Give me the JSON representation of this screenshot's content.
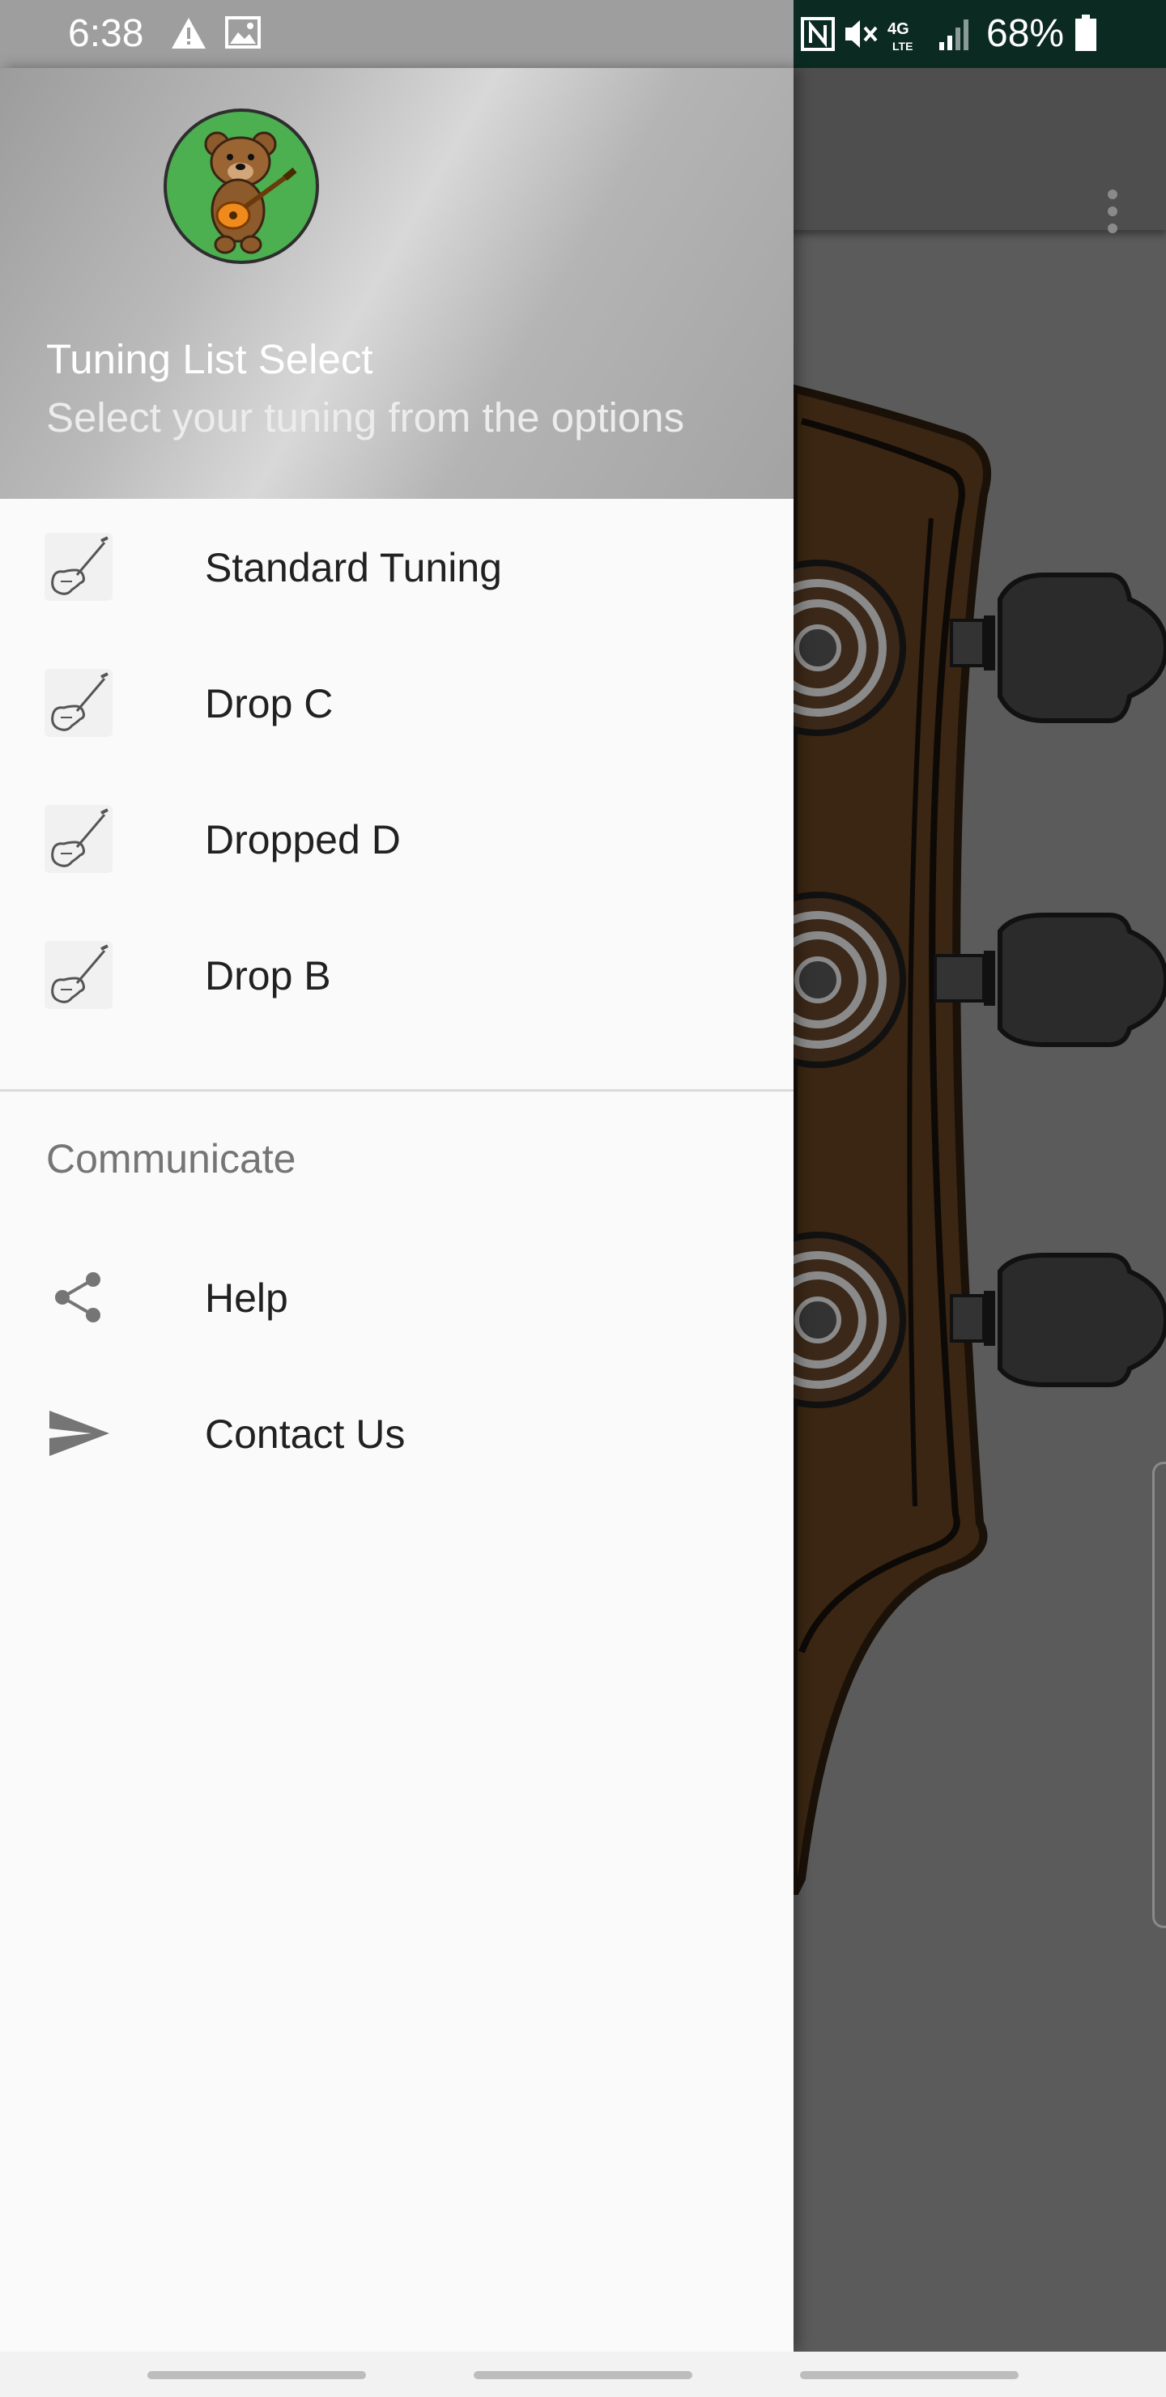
{
  "status_bar": {
    "time": "6:38",
    "battery": "68%",
    "left_icons": [
      "warning-icon",
      "image-icon"
    ],
    "right_icons": [
      "nfc-icon",
      "vibrate-mute-icon",
      "4g-lte-icon",
      "signal-icon",
      "battery-icon"
    ]
  },
  "app": {
    "toolbar_menu_icon": "overflow-menu-icon"
  },
  "drawer": {
    "header": {
      "title": "Tuning List Select",
      "subtitle": "Select your tuning from the options"
    },
    "tunings": [
      {
        "label": "Standard Tuning",
        "icon": "guitar-icon"
      },
      {
        "label": "Drop C",
        "icon": "guitar-icon"
      },
      {
        "label": "Dropped D",
        "icon": "guitar-icon"
      },
      {
        "label": "Drop B",
        "icon": "guitar-icon"
      }
    ],
    "section_title": "Communicate",
    "communicate": [
      {
        "label": "Help",
        "icon": "share-icon"
      },
      {
        "label": "Contact Us",
        "icon": "send-icon"
      }
    ]
  },
  "colors": {
    "drawer_background": "#fafafa",
    "status_right": "#0b2a22",
    "headstock_wood": "#3a2612",
    "avatar_bg": "#4caf50"
  }
}
